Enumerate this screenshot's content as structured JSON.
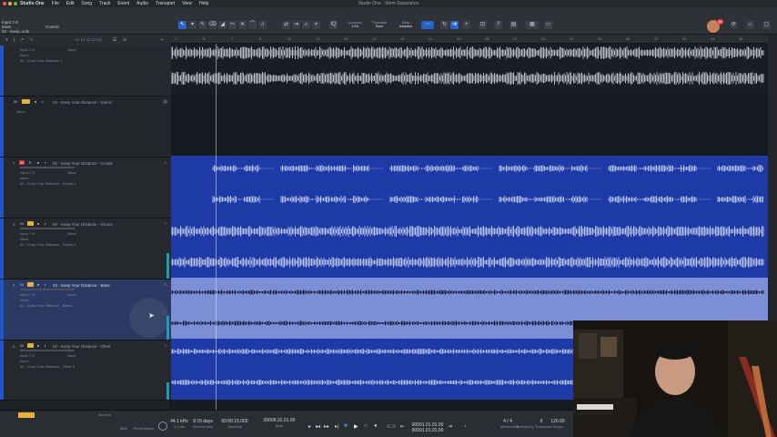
{
  "app": {
    "name": "Studio One",
    "window_title": "Studio One - Stem Separation",
    "menus": [
      "File",
      "Edit",
      "Song",
      "Track",
      "Event",
      "Audio",
      "Transport",
      "View",
      "Help"
    ]
  },
  "toolbar": {
    "input_label": "Input 7-8",
    "mute_label": "Mute",
    "source_label": "02 - Keep..vols",
    "control_label": "Control",
    "quantize": {
      "label": "Quantize",
      "value": "1/16"
    },
    "timebase": {
      "label": "Timebase",
      "value": "Bars"
    },
    "snap": {
      "label": "Snap",
      "value": "Adaptive"
    },
    "notification_count": "10"
  },
  "ruler": {
    "marks": [
      "1",
      "5",
      "7",
      "9",
      "11",
      "13",
      "15",
      "17",
      "19",
      "21",
      "23",
      "25",
      "27",
      "29",
      "31",
      "33",
      "35",
      "37",
      "39",
      "41",
      "43",
      "45"
    ]
  },
  "tracks": [
    {
      "num": "",
      "name": "",
      "input": "Input 7-8",
      "sub1": "None",
      "sub2": "02 - Keep Your Distance 1",
      "mode": "None",
      "lane_style": "dark",
      "wave_color": "#b9bcc4"
    },
    {
      "num": "",
      "name": "02 - Keep Your Distance - Stems",
      "input": "",
      "sub1": "None",
      "sub2": "",
      "mode": "",
      "lane_style": "dark",
      "wave_color": ""
    },
    {
      "num": "7",
      "name": "02 - Keep Your Distance - Vocals",
      "input": "Input 7-8",
      "sub1": "None",
      "sub2": "02 - Keep Your Distance - Vocals 1",
      "mode": "None",
      "lane_style": "blue",
      "wave_color": "#b7c2ec"
    },
    {
      "num": "3",
      "name": "02 - Keep Your Distance - Drums",
      "input": "Input 7-8",
      "sub1": "None",
      "sub2": "02 - Keep Your Distance - Drums 1",
      "mode": "None",
      "lane_style": "blue",
      "wave_color": "#b7c2ec"
    },
    {
      "num": "4",
      "name": "02 - Keep Your Distance - Bass",
      "input": "Input 7-8",
      "sub1": "None",
      "sub2": "02 - Keep Your Distance - Bass 1",
      "mode": "None",
      "lane_style": "light",
      "wave_color": "#12183a"
    },
    {
      "num": "5",
      "name": "02 - Keep Your Distance - Other",
      "input": "Input 7-8",
      "sub1": "None",
      "sub2": "02 - Keep Your Distance - Other 1",
      "mode": "None",
      "lane_style": "blue",
      "wave_color": "#b7c2ec"
    }
  ],
  "transport": {
    "midi_label": "MIDI",
    "performance_label": "Performance",
    "sample_rate": "44.1 kHz",
    "latency": "3.0 ms",
    "record_max": "9:15 days",
    "record_max_label": "Record Max",
    "seconds_value": "00:00:15.000",
    "seconds_label": "Seconds",
    "position": "00006.01.01.00",
    "position_label": "Bars",
    "loop_start": "00001.01.01.00",
    "loop_end": "00001.01.01.00",
    "signature": "4 / 4",
    "signature_label": "Metronome",
    "timing_label": "Timing",
    "key_label": "Key",
    "transpose": "0",
    "transpose_label": "Transpose",
    "tempo": "120.00",
    "tempo_label": "Tempo",
    "mixer_label": "Normal"
  }
}
